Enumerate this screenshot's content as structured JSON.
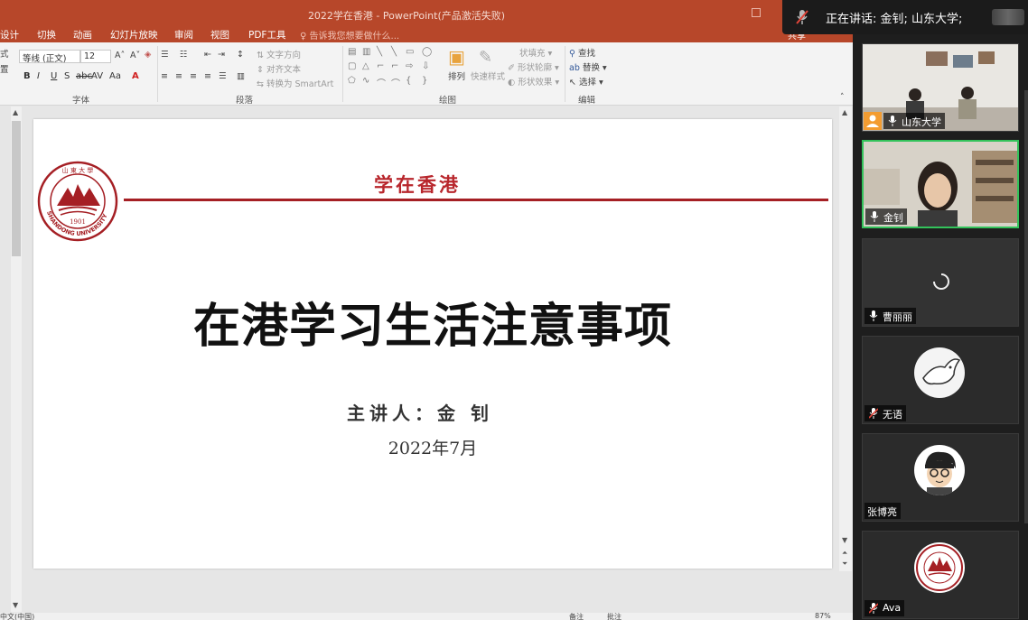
{
  "window": {
    "title": "2022学在香港 - PowerPoint(产品激活失败)"
  },
  "menu": {
    "items": [
      "设计",
      "切换",
      "动画",
      "幻灯片放映",
      "审阅",
      "视图",
      "PDF工具"
    ],
    "tell_me": "告诉我您想要做什么...",
    "share": "共享"
  },
  "ribbon": {
    "left_cut": [
      "式",
      "置"
    ],
    "font_name": "等线 (正文)",
    "font_size": "12",
    "groups": {
      "font": "字体",
      "paragraph": "段落",
      "drawing": "绘图",
      "editing": "编辑"
    },
    "paragraph_buttons": {
      "text_direction": "文字方向",
      "align_text": "对齐文本",
      "convert_smartart": "转换为 SmartArt"
    },
    "drawing_buttons": {
      "arrange": "排列",
      "quick_styles": "快速样式",
      "shape_fill": "状填充",
      "shape_outline": "形状轮廓",
      "shape_effects": "形状效果"
    },
    "editing_buttons": {
      "find": "查找",
      "replace": "替换",
      "select": "选择"
    }
  },
  "slide": {
    "header": "学在香港",
    "title": "在港学习生活注意事项",
    "speaker": "主讲人：金 钊",
    "date": "2022年7月",
    "logo": {
      "year": "1901",
      "text": "SHANDONG UNIVERSITY"
    },
    "colors": {
      "accent": "#b8262c",
      "rule": "#a51f24"
    }
  },
  "status": {
    "language": "中文(中国)",
    "notes": "备注",
    "comments": "批注",
    "zoom": "87%"
  },
  "meeting": {
    "speaking_label": "正在讲话: 金钊; 山东大学;",
    "participants": [
      {
        "name": "山东大学",
        "kind": "video-room",
        "mic": "on"
      },
      {
        "name": "金钊",
        "kind": "video-person",
        "mic": "on",
        "active": true
      },
      {
        "name": "曹丽丽",
        "kind": "loading",
        "mic": "on"
      },
      {
        "name": "无语",
        "kind": "avatar-dove",
        "mic": "muted"
      },
      {
        "name": "张博亮",
        "kind": "avatar-cartoon",
        "mic": "none"
      },
      {
        "name": "Ava",
        "kind": "avatar-logo",
        "mic": "muted"
      }
    ],
    "colors": {
      "active_border": "#33c35b",
      "muted": "#e0453a"
    }
  }
}
